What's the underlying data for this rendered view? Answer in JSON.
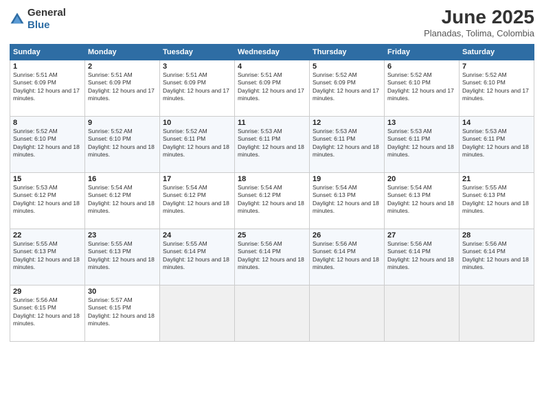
{
  "logo": {
    "general": "General",
    "blue": "Blue"
  },
  "title": "June 2025",
  "subtitle": "Planadas, Tolima, Colombia",
  "days_of_week": [
    "Sunday",
    "Monday",
    "Tuesday",
    "Wednesday",
    "Thursday",
    "Friday",
    "Saturday"
  ],
  "weeks": [
    [
      {
        "day": "1",
        "sunrise": "5:51 AM",
        "sunset": "6:09 PM",
        "daylight": "12 hours and 17 minutes."
      },
      {
        "day": "2",
        "sunrise": "5:51 AM",
        "sunset": "6:09 PM",
        "daylight": "12 hours and 17 minutes."
      },
      {
        "day": "3",
        "sunrise": "5:51 AM",
        "sunset": "6:09 PM",
        "daylight": "12 hours and 17 minutes."
      },
      {
        "day": "4",
        "sunrise": "5:51 AM",
        "sunset": "6:09 PM",
        "daylight": "12 hours and 17 minutes."
      },
      {
        "day": "5",
        "sunrise": "5:52 AM",
        "sunset": "6:09 PM",
        "daylight": "12 hours and 17 minutes."
      },
      {
        "day": "6",
        "sunrise": "5:52 AM",
        "sunset": "6:10 PM",
        "daylight": "12 hours and 17 minutes."
      },
      {
        "day": "7",
        "sunrise": "5:52 AM",
        "sunset": "6:10 PM",
        "daylight": "12 hours and 17 minutes."
      }
    ],
    [
      {
        "day": "8",
        "sunrise": "5:52 AM",
        "sunset": "6:10 PM",
        "daylight": "12 hours and 18 minutes."
      },
      {
        "day": "9",
        "sunrise": "5:52 AM",
        "sunset": "6:10 PM",
        "daylight": "12 hours and 18 minutes."
      },
      {
        "day": "10",
        "sunrise": "5:52 AM",
        "sunset": "6:11 PM",
        "daylight": "12 hours and 18 minutes."
      },
      {
        "day": "11",
        "sunrise": "5:53 AM",
        "sunset": "6:11 PM",
        "daylight": "12 hours and 18 minutes."
      },
      {
        "day": "12",
        "sunrise": "5:53 AM",
        "sunset": "6:11 PM",
        "daylight": "12 hours and 18 minutes."
      },
      {
        "day": "13",
        "sunrise": "5:53 AM",
        "sunset": "6:11 PM",
        "daylight": "12 hours and 18 minutes."
      },
      {
        "day": "14",
        "sunrise": "5:53 AM",
        "sunset": "6:11 PM",
        "daylight": "12 hours and 18 minutes."
      }
    ],
    [
      {
        "day": "15",
        "sunrise": "5:53 AM",
        "sunset": "6:12 PM",
        "daylight": "12 hours and 18 minutes."
      },
      {
        "day": "16",
        "sunrise": "5:54 AM",
        "sunset": "6:12 PM",
        "daylight": "12 hours and 18 minutes."
      },
      {
        "day": "17",
        "sunrise": "5:54 AM",
        "sunset": "6:12 PM",
        "daylight": "12 hours and 18 minutes."
      },
      {
        "day": "18",
        "sunrise": "5:54 AM",
        "sunset": "6:12 PM",
        "daylight": "12 hours and 18 minutes."
      },
      {
        "day": "19",
        "sunrise": "5:54 AM",
        "sunset": "6:13 PM",
        "daylight": "12 hours and 18 minutes."
      },
      {
        "day": "20",
        "sunrise": "5:54 AM",
        "sunset": "6:13 PM",
        "daylight": "12 hours and 18 minutes."
      },
      {
        "day": "21",
        "sunrise": "5:55 AM",
        "sunset": "6:13 PM",
        "daylight": "12 hours and 18 minutes."
      }
    ],
    [
      {
        "day": "22",
        "sunrise": "5:55 AM",
        "sunset": "6:13 PM",
        "daylight": "12 hours and 18 minutes."
      },
      {
        "day": "23",
        "sunrise": "5:55 AM",
        "sunset": "6:13 PM",
        "daylight": "12 hours and 18 minutes."
      },
      {
        "day": "24",
        "sunrise": "5:55 AM",
        "sunset": "6:14 PM",
        "daylight": "12 hours and 18 minutes."
      },
      {
        "day": "25",
        "sunrise": "5:56 AM",
        "sunset": "6:14 PM",
        "daylight": "12 hours and 18 minutes."
      },
      {
        "day": "26",
        "sunrise": "5:56 AM",
        "sunset": "6:14 PM",
        "daylight": "12 hours and 18 minutes."
      },
      {
        "day": "27",
        "sunrise": "5:56 AM",
        "sunset": "6:14 PM",
        "daylight": "12 hours and 18 minutes."
      },
      {
        "day": "28",
        "sunrise": "5:56 AM",
        "sunset": "6:14 PM",
        "daylight": "12 hours and 18 minutes."
      }
    ],
    [
      {
        "day": "29",
        "sunrise": "5:56 AM",
        "sunset": "6:15 PM",
        "daylight": "12 hours and 18 minutes."
      },
      {
        "day": "30",
        "sunrise": "5:57 AM",
        "sunset": "6:15 PM",
        "daylight": "12 hours and 18 minutes."
      },
      null,
      null,
      null,
      null,
      null
    ]
  ],
  "labels": {
    "sunrise": "Sunrise:",
    "sunset": "Sunset:",
    "daylight": "Daylight:"
  }
}
